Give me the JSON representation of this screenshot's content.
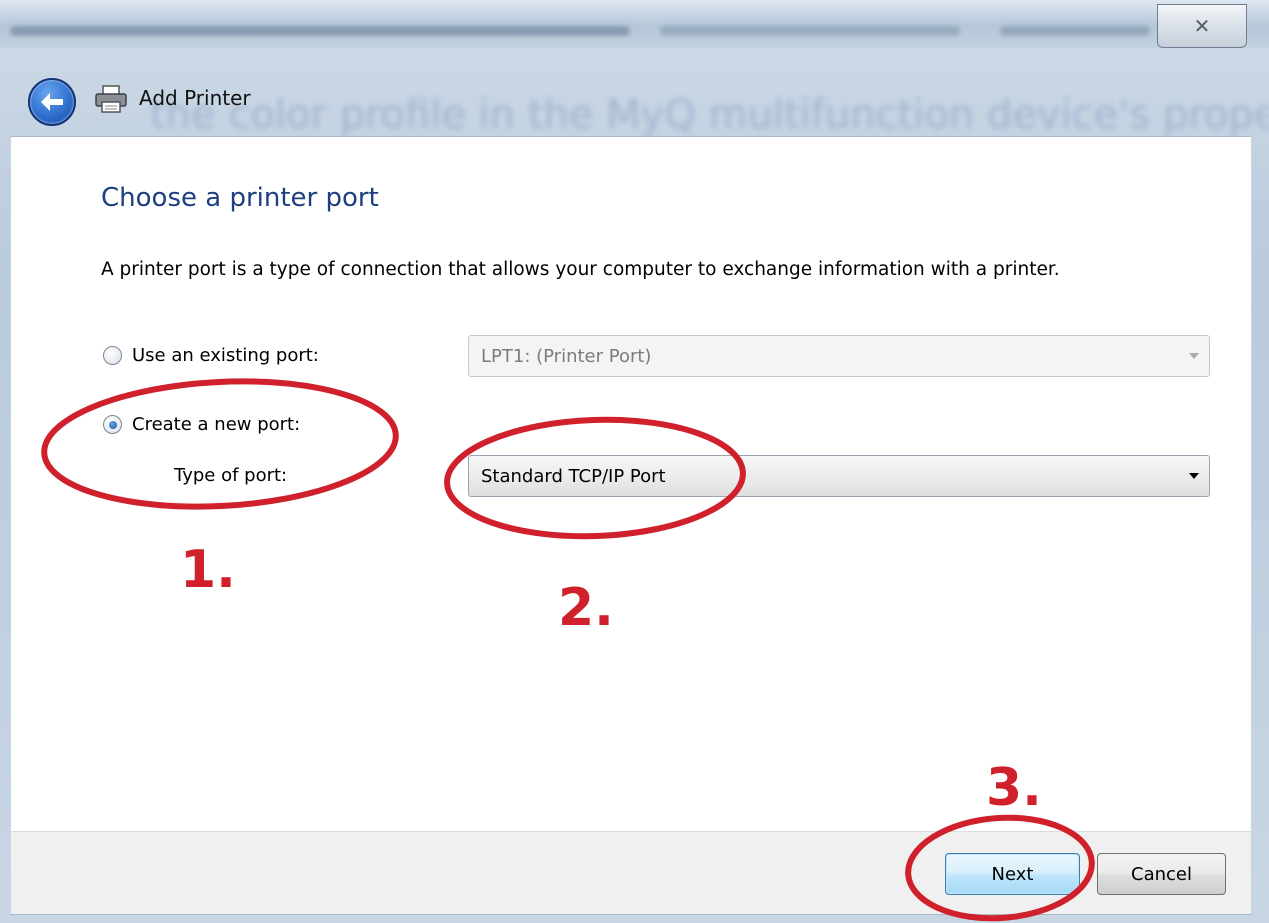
{
  "background": {
    "blurred_text": "the color profile in the MyQ multifunction device's properti"
  },
  "titlebar": {
    "close_glyph": "✕"
  },
  "caption": {
    "title": "Add Printer"
  },
  "content": {
    "heading": "Choose a printer port",
    "description": "A printer port is a type of connection that allows your computer to exchange information with a printer.",
    "existing_port": {
      "label": "Use an existing port:",
      "selected": false,
      "value": "LPT1: (Printer Port)",
      "disabled": true
    },
    "new_port": {
      "label": "Create a new port:",
      "selected": true
    },
    "type_of_port": {
      "label": "Type of port:",
      "value": "Standard TCP/IP Port"
    }
  },
  "footer": {
    "next_label": "Next",
    "cancel_label": "Cancel"
  },
  "annotations": {
    "step1": "1.",
    "step2": "2.",
    "step3": "3.",
    "color": "#d0202b"
  },
  "icons": {
    "back": "back-arrow-icon",
    "printer": "printer-icon",
    "close": "close-icon"
  }
}
